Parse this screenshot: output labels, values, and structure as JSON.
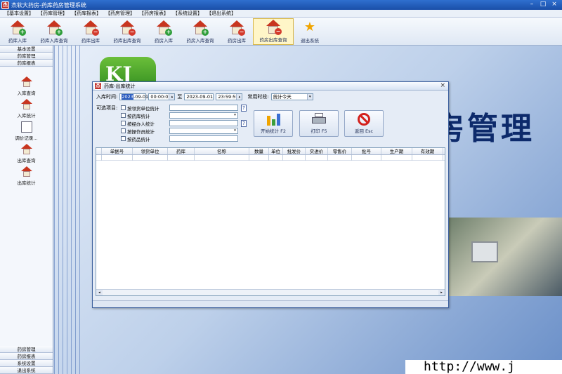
{
  "window": {
    "title": "杰软大药房-药库药房管理系统",
    "icon_text": "杰",
    "min": "–",
    "max": "□",
    "close": "×"
  },
  "menu": [
    "【基本设置】",
    "【药库管理】",
    "【药库报表】",
    "【药房管理】",
    "【药房报表】",
    "【系统设置】",
    "【退出系统】"
  ],
  "toolbar": [
    {
      "label": "药库入库",
      "badge": "+",
      "badge_color": "green"
    },
    {
      "label": "药库入库查询",
      "badge": "+",
      "badge_color": "green"
    },
    {
      "label": "药库出库",
      "badge": "−",
      "badge_color": "red"
    },
    {
      "label": "药库出库查询",
      "badge": "−",
      "badge_color": "red"
    },
    {
      "label": "药房入库",
      "badge": "+",
      "badge_color": "green"
    },
    {
      "label": "药房入库查询",
      "badge": "+",
      "badge_color": "green"
    },
    {
      "label": "药房出库",
      "badge": "−",
      "badge_color": "red"
    },
    {
      "label": "药房出库查询",
      "badge": "−",
      "badge_color": "red",
      "active": true
    },
    {
      "label": "退出系统",
      "icon": "runner-icon"
    }
  ],
  "sidebar": {
    "top_cats": [
      "基本设置",
      "药库管理",
      "药库报表"
    ],
    "items": [
      {
        "label": "入库查询",
        "icon": "house"
      },
      {
        "label": "入库统计",
        "icon": "house"
      },
      {
        "label": "调价记录...",
        "icon": "doc"
      },
      {
        "label": "出库查询",
        "icon": "house"
      },
      {
        "label": "出库统计",
        "icon": "house"
      }
    ],
    "bottom_cats": [
      "药房管理",
      "药房报表",
      "系统设置",
      "退出系统"
    ]
  },
  "desktop": {
    "big_title": "房管理",
    "url": "http://www.j",
    "logo": "KJ"
  },
  "dialog": {
    "title": "药库-出库统计",
    "icon_text": "杰",
    "close": "×",
    "time_label": "入库时间:",
    "date_from": "2023-09-01",
    "date_from_sel": "2023",
    "date_from_rest": "-09-01",
    "time_from": "00:00:01",
    "to_label": "至",
    "date_to": "2023-09-01",
    "time_to": "23:59:59",
    "period_label": "常用时段:",
    "period_value": "统计今天",
    "options_label": "可选项目:",
    "options": [
      {
        "label": "按领货单位统计",
        "has_combo": false,
        "has_query": true
      },
      {
        "label": "按药库统计",
        "has_combo": true,
        "has_query": false
      },
      {
        "label": "按经办人统计",
        "has_combo": false,
        "has_query": true
      },
      {
        "label": "按操作员统计",
        "has_combo": true,
        "has_query": false
      },
      {
        "label": "按药品统计",
        "has_combo": false,
        "has_query": false
      }
    ],
    "buttons": {
      "start": "开始统计 F2",
      "print": "打印 F5",
      "back": "返回 Esc"
    },
    "columns": [
      "单据号",
      "领货单位",
      "药库",
      "名称",
      "数量",
      "单位",
      "批发价",
      "实进价",
      "零售价",
      "批号",
      "生产期",
      "有效期"
    ]
  }
}
